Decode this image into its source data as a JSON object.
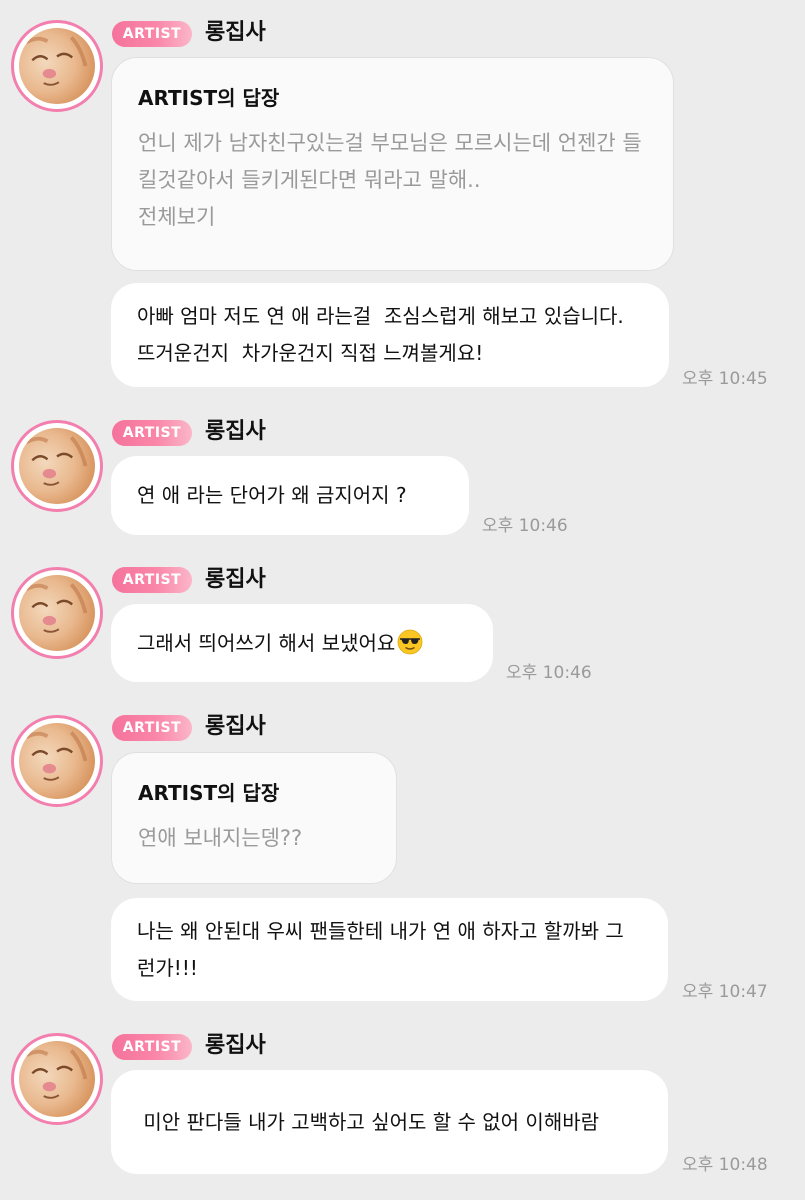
{
  "colors": {
    "background": "#ececec",
    "badge_gradient_start": "#f5739c",
    "badge_gradient_end": "#fbb6c9",
    "avatar_ring": "#f27fae",
    "muted_text": "#9a9a9a"
  },
  "groups": [
    {
      "badge": "ARTIST",
      "sender": "롱집사",
      "reply": {
        "title": "ARTIST의 답장",
        "text": "언니 제가 남자친구있는걸 부모님은 모르시는데 언젠간 들킬것같아서 들키게된다면 뭐라고 말해..",
        "more": "전체보기"
      },
      "message": "아빠 엄마 저도 연 애 라는걸  조심스럽게 해보고 있습니다. 뜨거운건지  차가운건지 직접 느껴볼게요!",
      "time": "오후 10:45"
    },
    {
      "badge": "ARTIST",
      "sender": "롱집사",
      "message": "연 애 라는 단어가 왜 금지어지 ?",
      "time": "오후 10:46"
    },
    {
      "badge": "ARTIST",
      "sender": "롱집사",
      "message": "그래서 띄어쓰기 해서 보냈어요",
      "emoji": "smiling-face-with-sunglasses",
      "time": "오후 10:46"
    },
    {
      "badge": "ARTIST",
      "sender": "롱집사",
      "reply": {
        "title": "ARTIST의 답장",
        "text": "연애 보내지는뎅??"
      },
      "message": "나는 왜 안된대 우씨 팬들한테 내가 연 애 하자고 할까봐 그런가!!!",
      "time": "오후 10:47"
    },
    {
      "badge": "ARTIST",
      "sender": "롱집사",
      "message": " 미안 판다들 내가 고백하고 싶어도 할 수 없어 이해바람",
      "time": "오후 10:48"
    }
  ]
}
